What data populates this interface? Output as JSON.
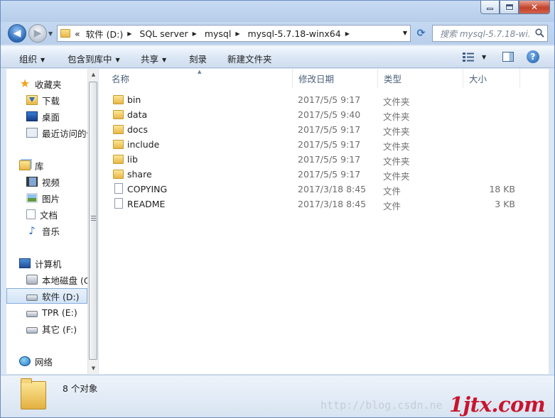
{
  "window": {
    "controls": {
      "minimize": "minimize-icon",
      "maximize": "maximize-icon",
      "close": "close-icon"
    }
  },
  "navigation": {
    "back_icon": "back-arrow-icon",
    "forward_icon": "forward-arrow-icon",
    "history_icon": "chevron-down-icon"
  },
  "address": {
    "overflow": "«",
    "crumbs": [
      "软件 (D:)",
      "SQL server",
      "mysql",
      "mysql-5.7.18-winx64"
    ],
    "refresh_icon": "refresh-icon"
  },
  "search": {
    "placeholder": "搜索 mysql-5.7.18-wi...",
    "icon": "magnifier-icon"
  },
  "toolbar": {
    "organize": "组织",
    "include_in_library": "包含到库中",
    "share": "共享",
    "burn": "刻录",
    "new_folder": "新建文件夹"
  },
  "nav_pane": {
    "favorites": {
      "label": "收藏夹",
      "items": [
        "下载",
        "桌面",
        "最近访问的位置"
      ]
    },
    "libraries": {
      "label": "库",
      "items": [
        "视频",
        "图片",
        "文档",
        "音乐"
      ]
    },
    "computer": {
      "label": "计算机",
      "items": [
        "本地磁盘 (C:)",
        "软件 (D:)",
        "TPR (E:)",
        "其它 (F:)"
      ],
      "selected": "软件 (D:)"
    },
    "network": {
      "label": "网络"
    }
  },
  "columns": {
    "name": "名称",
    "date": "修改日期",
    "type": "类型",
    "size": "大小"
  },
  "files": [
    {
      "name": "bin",
      "date": "2017/5/5 9:17",
      "type": "文件夹",
      "size": "",
      "kind": "folder"
    },
    {
      "name": "data",
      "date": "2017/5/5 9:40",
      "type": "文件夹",
      "size": "",
      "kind": "folder"
    },
    {
      "name": "docs",
      "date": "2017/5/5 9:17",
      "type": "文件夹",
      "size": "",
      "kind": "folder"
    },
    {
      "name": "include",
      "date": "2017/5/5 9:17",
      "type": "文件夹",
      "size": "",
      "kind": "folder"
    },
    {
      "name": "lib",
      "date": "2017/5/5 9:17",
      "type": "文件夹",
      "size": "",
      "kind": "folder"
    },
    {
      "name": "share",
      "date": "2017/5/5 9:17",
      "type": "文件夹",
      "size": "",
      "kind": "folder"
    },
    {
      "name": "COPYING",
      "date": "2017/3/18 8:45",
      "type": "文件",
      "size": "18 KB",
      "kind": "file"
    },
    {
      "name": "README",
      "date": "2017/3/18 8:45",
      "type": "文件",
      "size": "3 KB",
      "kind": "file"
    }
  ],
  "status": {
    "count_text": "8 个对象"
  },
  "watermark": {
    "url": "http://blog.csdn.ne",
    "logo": "1jtx.com"
  }
}
